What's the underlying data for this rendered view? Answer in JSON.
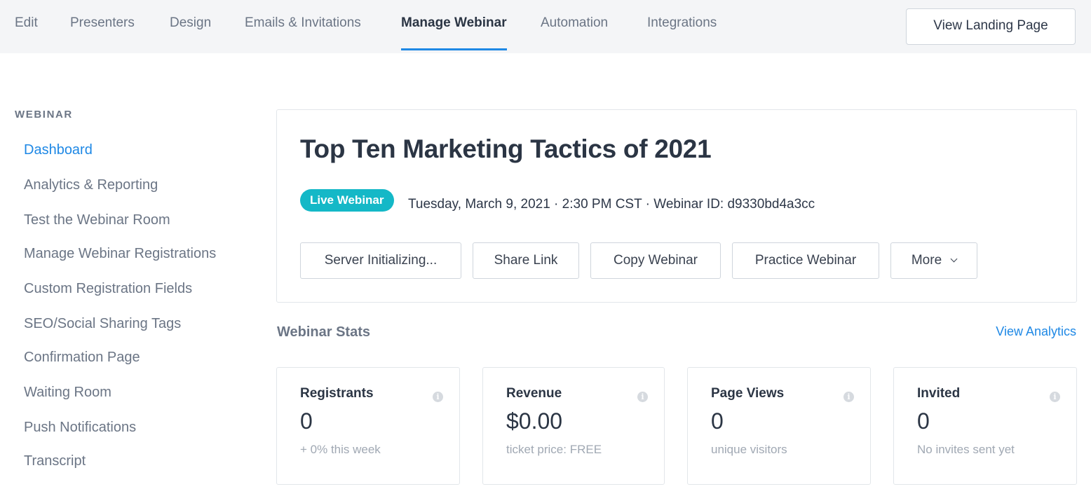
{
  "topnav": {
    "tabs": [
      {
        "label": "Edit"
      },
      {
        "label": "Presenters"
      },
      {
        "label": "Design"
      },
      {
        "label": "Emails & Invitations"
      },
      {
        "label": "Manage Webinar",
        "active": true
      },
      {
        "label": "Automation"
      },
      {
        "label": "Integrations"
      }
    ],
    "view_landing_label": "View Landing Page"
  },
  "sidebar": {
    "header": "WEBINAR",
    "items": [
      {
        "label": "Dashboard",
        "active": true
      },
      {
        "label": "Analytics & Reporting"
      },
      {
        "label": "Test the Webinar Room"
      },
      {
        "label": "Manage Webinar Registrations"
      },
      {
        "label": "Custom Registration Fields"
      },
      {
        "label": "SEO/Social Sharing Tags"
      },
      {
        "label": "Confirmation Page"
      },
      {
        "label": "Waiting Room"
      },
      {
        "label": "Push Notifications"
      },
      {
        "label": "Transcript"
      }
    ]
  },
  "webinar": {
    "title": "Top Ten Marketing Tactics of 2021",
    "badge": "Live Webinar",
    "meta": "Tuesday, March 9, 2021 · 2:30 PM CST · Webinar ID: d9330bd4a3cc",
    "actions": {
      "server": "Server Initializing...",
      "share": "Share Link",
      "copy": "Copy Webinar",
      "practice": "Practice Webinar",
      "more": "More"
    }
  },
  "stats": {
    "title": "Webinar Stats",
    "view_analytics": "View Analytics",
    "cards": [
      {
        "label": "Registrants",
        "value": "0",
        "sub": "+ 0% this week"
      },
      {
        "label": "Revenue",
        "value": "$0.00",
        "sub": "ticket price: FREE"
      },
      {
        "label": "Page Views",
        "value": "0",
        "sub": "unique visitors"
      },
      {
        "label": "Invited",
        "value": "0",
        "sub": "No invites sent yet"
      }
    ]
  },
  "colors": {
    "accent": "#1e88e5",
    "badge": "#14b8c7"
  },
  "icons": {
    "info": "info-icon",
    "more_dropdown": "chevron-down-icon"
  }
}
